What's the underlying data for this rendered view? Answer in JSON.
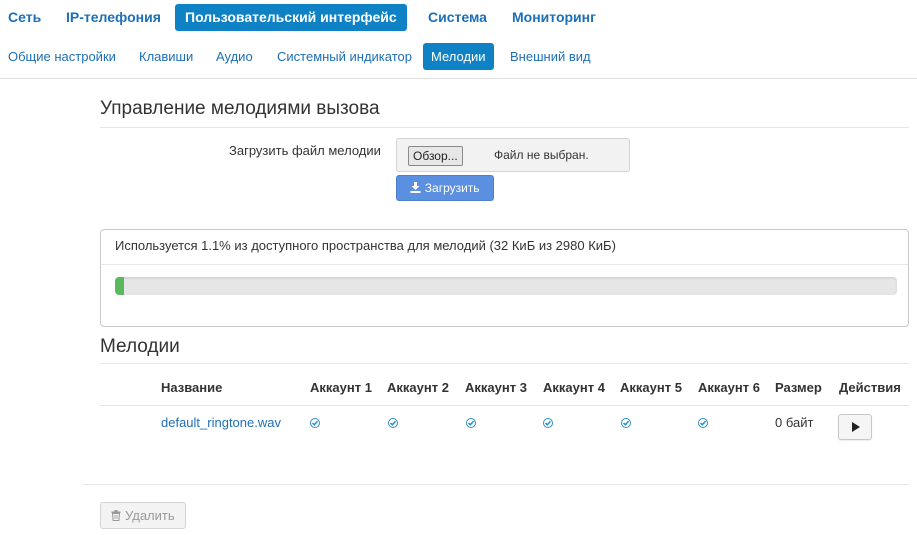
{
  "main_nav": [
    "Сеть",
    "IP-телефония",
    "Пользовательский интерфейс",
    "Система",
    "Мониторинг"
  ],
  "sub_nav": [
    "Общие настройки",
    "Клавиши",
    "Аудио",
    "Системный индикатор",
    "Мелодии",
    "Внешний вид"
  ],
  "ringtone_mgmt": {
    "title": "Управление мелодиями вызова",
    "upload_label": "Загрузить файл мелодии",
    "browse_button": "Обзор...",
    "file_status": "Файл не выбран.",
    "upload_button": "Загрузить",
    "upload_icon": "download-icon"
  },
  "storage": {
    "text": "Используется 1.1% из доступного пространства для мелодий (32 КиБ из 2980 КиБ)",
    "used_percent": 1.1,
    "bar_color": "#5cb85c"
  },
  "melodies": {
    "title": "Мелодии",
    "columns": [
      "Название",
      "Аккаунт 1",
      "Аккаунт 2",
      "Аккаунт 3",
      "Аккаунт 4",
      "Аккаунт 5",
      "Аккаунт 6",
      "Размер",
      "Действия"
    ],
    "rows": [
      {
        "name": "default_ringtone.wav",
        "accounts": [
          true,
          true,
          true,
          true,
          true,
          true
        ],
        "size": "0 байт"
      }
    ]
  },
  "delete_button": "Удалить",
  "colors": {
    "accent": "#0e82c5",
    "link": "#1d6fb7"
  }
}
